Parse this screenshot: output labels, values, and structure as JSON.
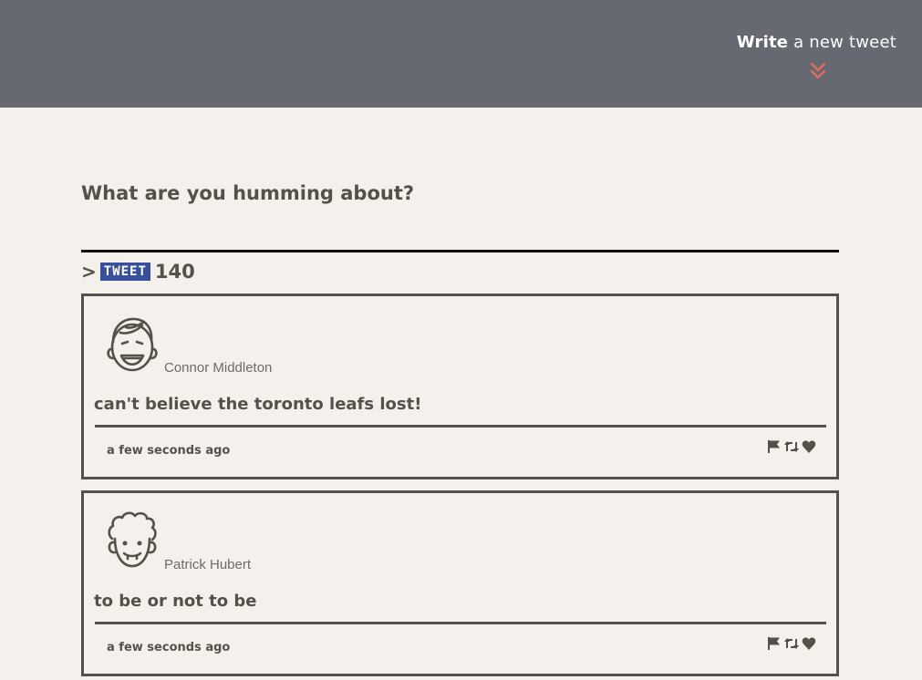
{
  "header": {
    "write_bold": "Write",
    "write_rest": " a new tweet"
  },
  "composer": {
    "label": "What are you humming about?",
    "input_value": "",
    "input_placeholder": "",
    "caret": ">",
    "tweet_button": "TWEET",
    "counter": "140"
  },
  "tweets": [
    {
      "author": "Connor Middleton",
      "text": "can't believe the toronto leafs lost!",
      "time": "a few seconds ago"
    },
    {
      "author": "Patrick Hubert",
      "text": "to be or not to be",
      "time": "a few seconds ago"
    }
  ],
  "colors": {
    "header_bg": "#666872",
    "page_bg": "#f4f1ec",
    "accent_chevron": "#e46c5d",
    "tweet_button_bg": "#3a4f9a",
    "text_dark": "#545149"
  },
  "icons": [
    "chevron-double-down-icon",
    "flag-icon",
    "retweet-icon",
    "heart-icon"
  ]
}
